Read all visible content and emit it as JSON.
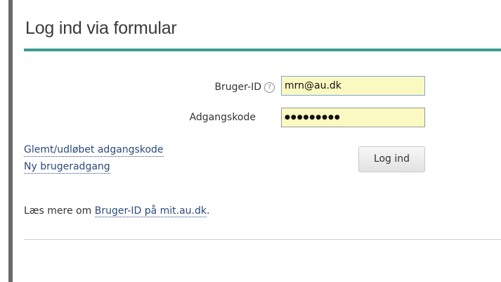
{
  "form": {
    "title": "Log ind via formular",
    "userid_label": "Bruger-ID",
    "help_glyph": "?",
    "userid_value": "mrn@au.dk",
    "password_label": "Adgangskode",
    "password_value": "●●●●●●●●●",
    "forgot_link": "Glemt/udløbet adgangskode",
    "new_user_link": "Ny brugeradgang",
    "login_button": "Log ind",
    "more_prefix": "Læs mere om ",
    "more_link": "Bruger-ID på mit.au.dk",
    "more_suffix": "."
  },
  "colors": {
    "accent_rule": "#3a9c8c",
    "field_bg": "#fbf9c2",
    "link": "#2b4a7a"
  },
  "icons": {
    "help": "help-circle-icon"
  }
}
